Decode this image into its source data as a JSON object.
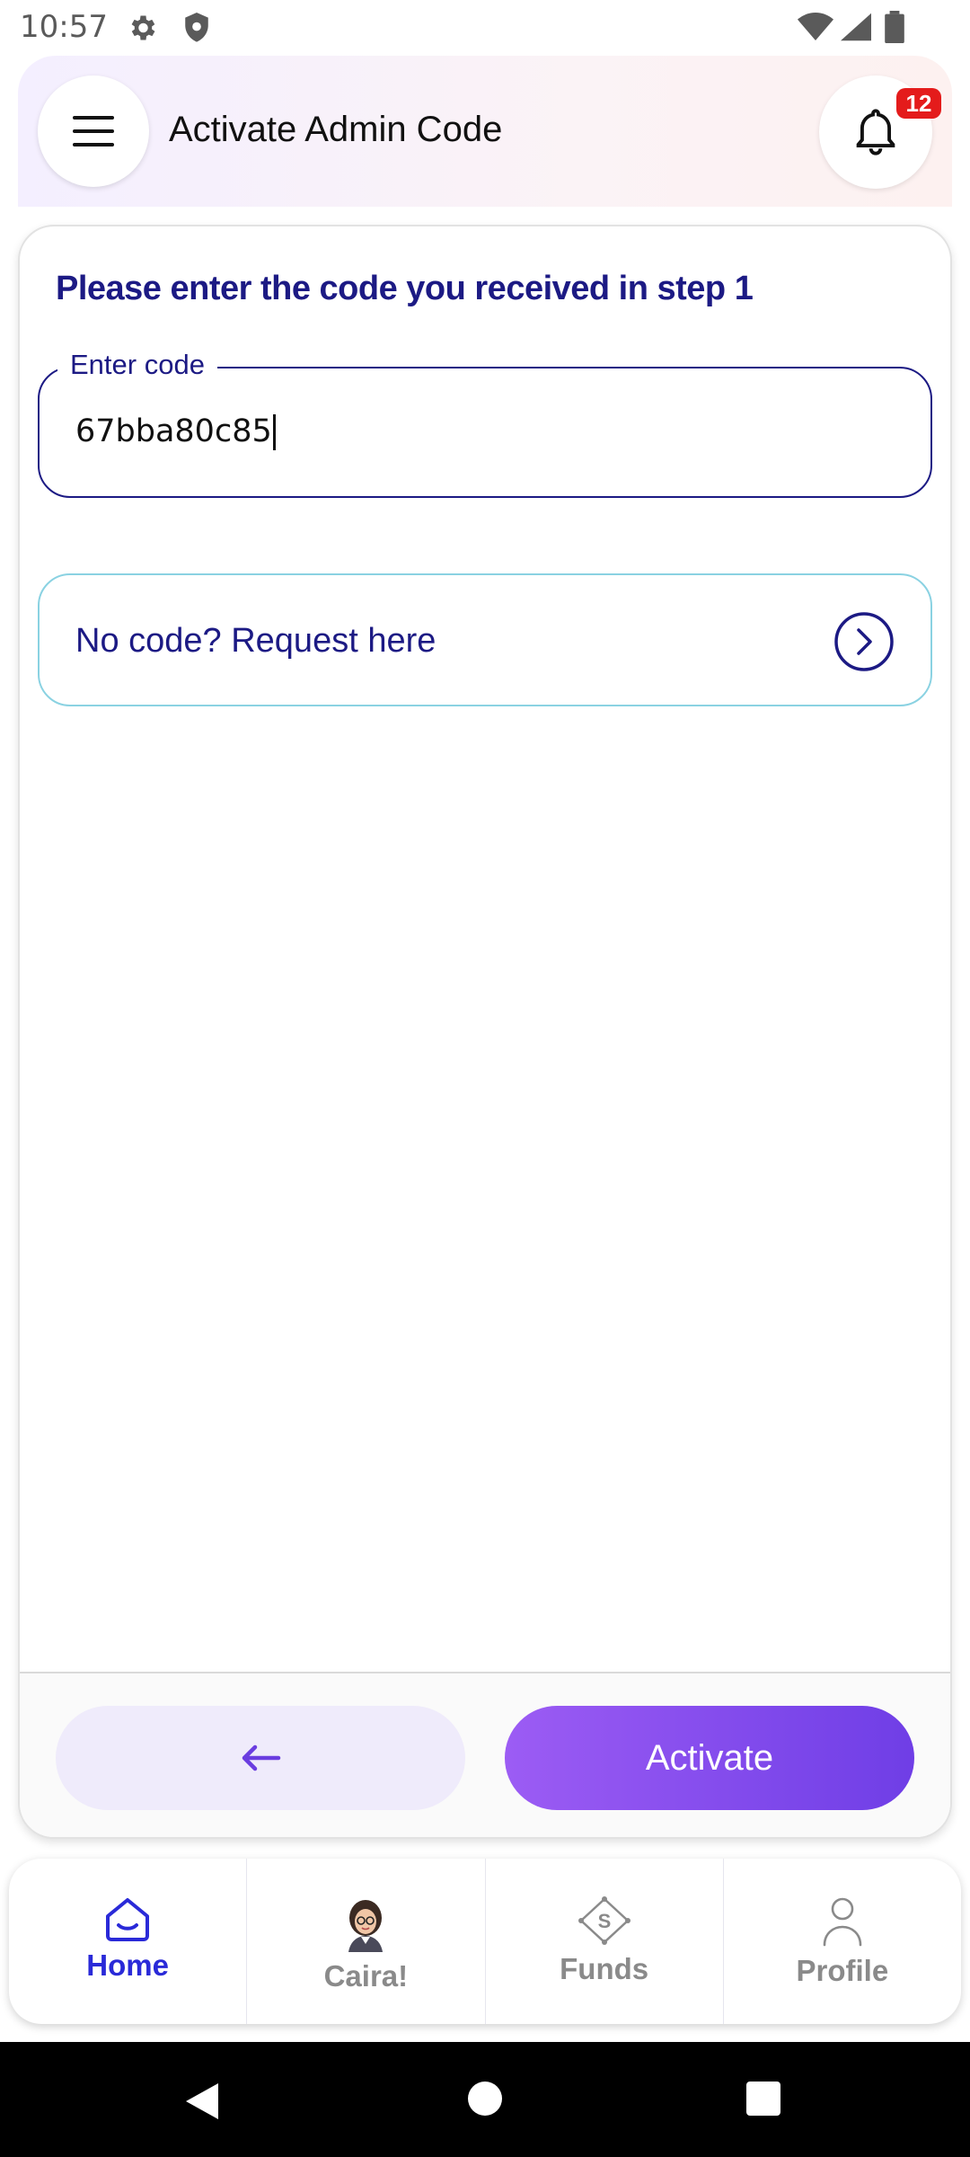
{
  "status_bar": {
    "time": "10:57"
  },
  "header": {
    "title": "Activate Admin Code",
    "notification_count": "12"
  },
  "form": {
    "instruction": "Please enter the code you received in step 1",
    "code_label": "Enter code",
    "code_value": "67bba80c85",
    "request_label": "No code? Request here"
  },
  "actions": {
    "activate_label": "Activate"
  },
  "bottom_nav": {
    "items": [
      {
        "label": "Home",
        "icon": "home-icon",
        "active": true
      },
      {
        "label": "Caira!",
        "icon": "assistant-avatar",
        "active": false
      },
      {
        "label": "Funds",
        "icon": "funds-icon",
        "active": false
      },
      {
        "label": "Profile",
        "icon": "profile-icon",
        "active": false
      }
    ]
  },
  "colors": {
    "primary_text": "#1c1a84",
    "accent_purple": "#7a46ec",
    "active_nav": "#2a2ad8",
    "badge": "#e41b1b",
    "request_border": "#8ad2e2"
  }
}
